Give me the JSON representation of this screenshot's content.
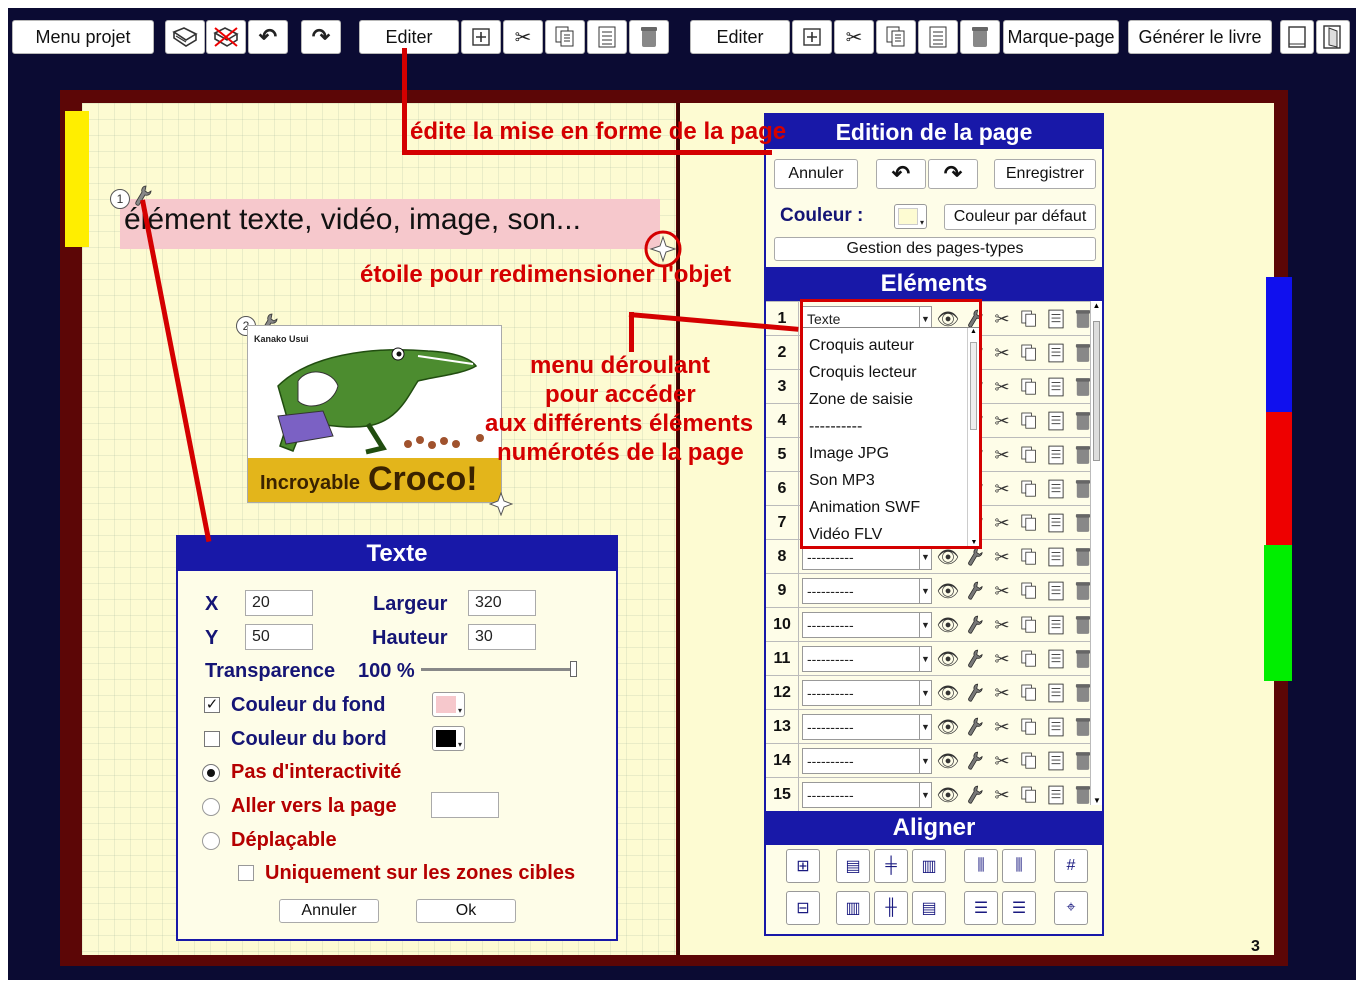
{
  "toolbar": {
    "menu_projet": "Menu projet",
    "editer1": "Editer",
    "editer2": "Editer",
    "marque_page": "Marque-page",
    "generer_livre": "Générer le livre"
  },
  "annotations": {
    "edit_layout": "édite la mise en forme de la page",
    "star_resize": "étoile pour redimensioner l'objet",
    "menu_line1": "menu déroulant",
    "menu_line2": "pour accéder",
    "menu_line3": "aux différents éléments",
    "menu_line4": "numérotés de la page"
  },
  "canvas": {
    "text_element": "élément texte, vidéo, image, son...",
    "marker1": "1",
    "marker2": "2",
    "image_author": "Kanako Usui",
    "image_title_small": "Incroyable",
    "image_title_big": "Croco!",
    "page_number": "3"
  },
  "text_panel": {
    "title": "Texte",
    "x_label": "X",
    "x_value": "20",
    "y_label": "Y",
    "y_value": "50",
    "width_label": "Largeur",
    "width_value": "320",
    "height_label": "Hauteur",
    "height_value": "30",
    "transparency_label": "Transparence",
    "transparency_value": "100 %",
    "transparency_level": 1.0,
    "bg_color_label": "Couleur du fond",
    "bg_color_checked": true,
    "bg_color": "#f6c8cc",
    "border_color_label": "Couleur du bord",
    "border_color_checked": false,
    "border_color": "#000000",
    "radio_none": "Pas d'interactivité",
    "radio_goto": "Aller vers la page",
    "radio_drag": "Déplaçable",
    "only_targets": "Uniquement sur les zones cibles",
    "cancel": "Annuler",
    "ok": "Ok"
  },
  "page_editor": {
    "title": "Edition de la page",
    "cancel": "Annuler",
    "save": "Enregistrer",
    "color_label": "Couleur :",
    "default_color": "Couleur par défaut",
    "page_types": "Gestion des pages-types",
    "page_color": "#fdfbd2"
  },
  "elements": {
    "title": "Eléments",
    "rows": [
      {
        "num": "1",
        "value": "Texte"
      },
      {
        "num": "2",
        "value": "----------"
      },
      {
        "num": "3",
        "value": "----------"
      },
      {
        "num": "4",
        "value": "----------"
      },
      {
        "num": "5",
        "value": "----------"
      },
      {
        "num": "6",
        "value": "----------"
      },
      {
        "num": "7",
        "value": "----------"
      },
      {
        "num": "8",
        "value": "----------"
      },
      {
        "num": "9",
        "value": "----------"
      },
      {
        "num": "10",
        "value": "----------"
      },
      {
        "num": "11",
        "value": "----------"
      },
      {
        "num": "12",
        "value": "----------"
      },
      {
        "num": "13",
        "value": "----------"
      },
      {
        "num": "14",
        "value": "----------"
      },
      {
        "num": "15",
        "value": "----------"
      }
    ],
    "dropdown_options": [
      "Croquis auteur",
      "Croquis lecteur",
      "Zone de saisie",
      "----------",
      "Image JPG",
      "Son MP3",
      "Animation SWF",
      "Vidéo FLV"
    ]
  },
  "align": {
    "title": "Aligner"
  },
  "colors": {
    "accent_red": "#d40000",
    "panel_blue": "#1818a8",
    "tab_yellow": "#ffee00",
    "tab_blue": "#1010ee",
    "tab_red": "#ee0000",
    "tab_green": "#00ee00"
  }
}
